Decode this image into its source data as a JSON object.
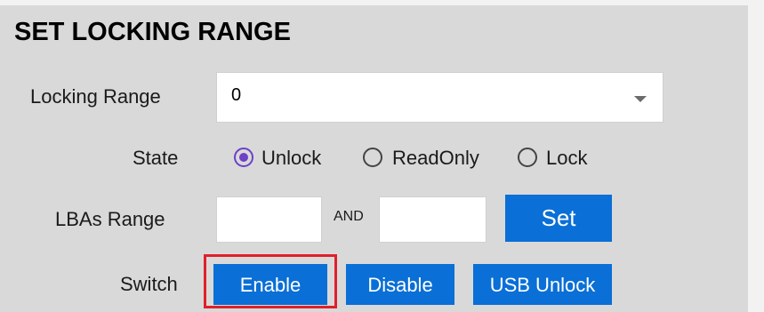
{
  "section": {
    "title": "SET LOCKING RANGE"
  },
  "locking_range": {
    "label": "Locking Range",
    "selected_value": "0"
  },
  "state": {
    "label": "State",
    "options": [
      {
        "label": "Unlock",
        "checked": true
      },
      {
        "label": "ReadOnly",
        "checked": false
      },
      {
        "label": "Lock",
        "checked": false
      }
    ]
  },
  "lbas_range": {
    "label": "LBAs Range",
    "start_value": "",
    "end_value": "",
    "separator": "AND",
    "set_label": "Set"
  },
  "switch": {
    "label": "Switch",
    "enable_label": "Enable",
    "disable_label": "Disable",
    "usb_unlock_label": "USB Unlock"
  },
  "colors": {
    "panel_bg": "#d9d9d9",
    "button_blue": "#0a6fd6",
    "radio_accent": "#6e3fc7",
    "highlight_red": "#e0202a"
  }
}
